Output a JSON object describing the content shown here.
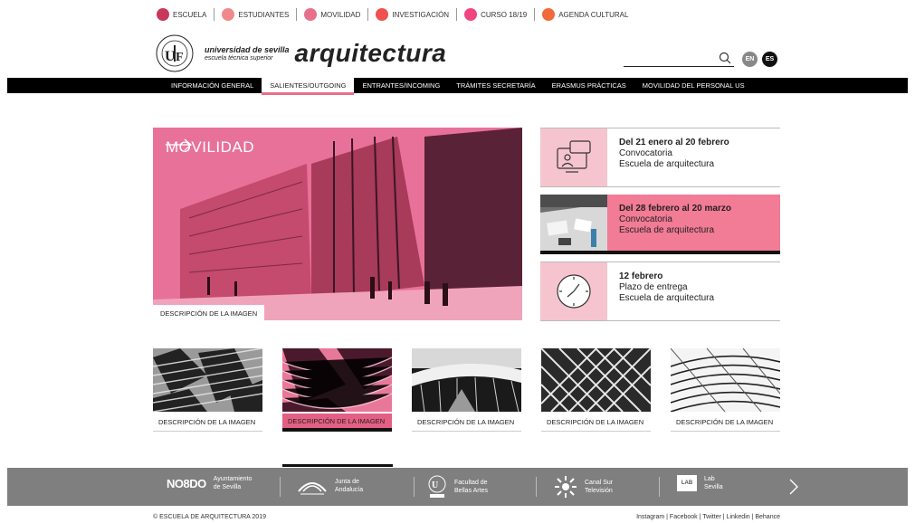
{
  "top_links": [
    {
      "label": "ESCUELA",
      "color": "#c8385a"
    },
    {
      "label": "ESTUDIANTES",
      "color": "#f08a8a"
    },
    {
      "label": "MOVILIDAD",
      "color": "#e8708c"
    },
    {
      "label": "INVESTIGACIÓN",
      "color": "#f05050"
    },
    {
      "label": "CURSO 18/19",
      "color": "#f04580"
    },
    {
      "label": "AGENDA CULTURAL",
      "color": "#f06a3a"
    }
  ],
  "logo": {
    "line1": "universidad de sevilla",
    "line2": "escuela técnica superior",
    "brand": "arquitectura"
  },
  "lang": {
    "en": "EN",
    "es": "ES"
  },
  "nav": [
    {
      "label": "INFORMACIÓN GENERAL",
      "active": false
    },
    {
      "label": "SALIENTES/OUTGOING",
      "active": true
    },
    {
      "label": "ENTRANTES/INCOMING",
      "active": false
    },
    {
      "label": "TRÁMITES SECRETARÍA",
      "active": false
    },
    {
      "label": "ERASMUS PRÁCTICAS",
      "active": false
    },
    {
      "label": "MOVILIDAD DEL PERSONAL US",
      "active": false
    }
  ],
  "hero": {
    "title": "MOVILIDAD",
    "caption": "DESCRIPCIÓN DE LA IMAGEN"
  },
  "events": [
    {
      "date": "Del 21 enero al 20 febrero",
      "line2": "Convocatoria",
      "line3": "Escuela de arquitectura",
      "icon": "chat-screen-icon"
    },
    {
      "date": "Del 28 febrero al 20 marzo",
      "line2": "Convocatoria",
      "line3": "Escuela de arquitectura",
      "icon": "photo"
    },
    {
      "date": "12 febrero",
      "line2": "Plazo de entrega",
      "line3": "Escuela de arquitectura",
      "icon": "clock-icon"
    }
  ],
  "gallery": [
    {
      "caption": "DESCRIPCIÓN DE LA IMAGEN",
      "active": false
    },
    {
      "caption": "DESCRIPCIÓN DE LA IMAGEN",
      "active": true
    },
    {
      "caption": "DESCRIPCIÓN DE LA IMAGEN",
      "active": false
    },
    {
      "caption": "DESCRIPCIÓN DE  LA IMAGEN",
      "active": false
    },
    {
      "caption": "DESCRIPCIÓN DE LA IMAGEN",
      "active": false
    }
  ],
  "partners": [
    {
      "logo": "NO8DO",
      "name": "Ayuntamiento\nde Sevilla"
    },
    {
      "logo": "junta",
      "name": "Junta de\nAndalucía"
    },
    {
      "logo": "us",
      "name": "Facultad de\nBellas Artes"
    },
    {
      "logo": "canalsur",
      "name": "Canal Sur\nTelevisión"
    },
    {
      "logo": "LAB",
      "name": "Lab\nSevilla"
    }
  ],
  "footer": {
    "copyright": "© ESCUELA DE ARQUITECTURA 2019",
    "social": "Instagram | Facebook | Twitter | Linkedin | Behance"
  }
}
